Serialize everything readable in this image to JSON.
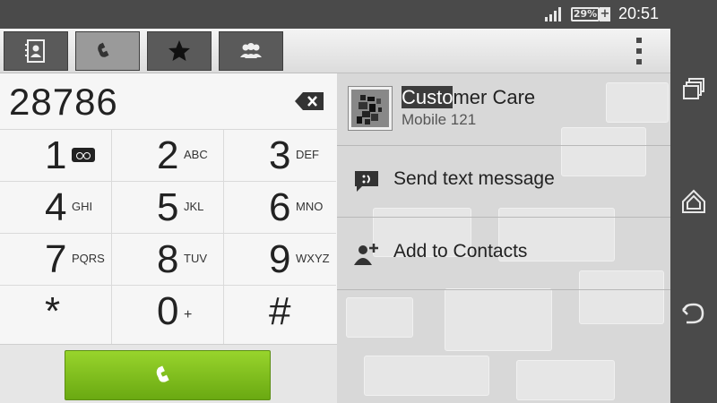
{
  "status_bar": {
    "battery_percent": "29%",
    "time": "20:51",
    "icons": [
      "signal-icon",
      "battery-icon",
      "charging-icon"
    ]
  },
  "tabs": [
    {
      "name": "contacts",
      "icon": "contacts-book-icon",
      "active": false
    },
    {
      "name": "phone",
      "icon": "phone-icon",
      "active": true
    },
    {
      "name": "favorites",
      "icon": "star-icon",
      "active": false
    },
    {
      "name": "groups",
      "icon": "groups-icon",
      "active": false
    }
  ],
  "dialpad": {
    "number": "28786",
    "keys": [
      {
        "digit": "1",
        "letters": "",
        "icon": "voicemail-icon"
      },
      {
        "digit": "2",
        "letters": "ABC"
      },
      {
        "digit": "3",
        "letters": "DEF"
      },
      {
        "digit": "4",
        "letters": "GHI"
      },
      {
        "digit": "5",
        "letters": "JKL"
      },
      {
        "digit": "6",
        "letters": "MNO"
      },
      {
        "digit": "7",
        "letters": "PQRS"
      },
      {
        "digit": "8",
        "letters": "TUV"
      },
      {
        "digit": "9",
        "letters": "WXYZ"
      },
      {
        "digit": "*",
        "letters": ""
      },
      {
        "digit": "0",
        "letters": "+"
      },
      {
        "digit": "#",
        "letters": ""
      }
    ]
  },
  "contact": {
    "name_match": "Custo",
    "name_rest": "mer Care",
    "subtitle": "Mobile 121"
  },
  "actions": {
    "send_text": "Send text message",
    "add_contact": "Add to Contacts"
  },
  "colors": {
    "call_green": "#7cbd1a",
    "highlight": "#3c3c3c"
  }
}
